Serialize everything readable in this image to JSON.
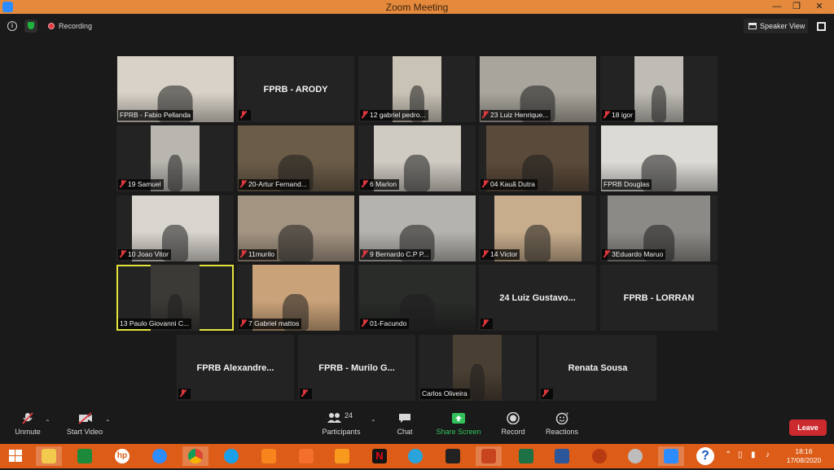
{
  "window": {
    "title": "Zoom Meeting"
  },
  "topbar": {
    "recording_label": "Recording",
    "speaker_view_label": "Speaker View"
  },
  "tiles": [
    {
      "name": "FPRB - Fabio Pellanda",
      "show_mic": false,
      "video": true,
      "bg": "#d8d2c8"
    },
    {
      "name": "FPRB - ARODY",
      "show_mic": true,
      "video": false
    },
    {
      "name": "12 gabriel pedro...",
      "show_mic": true,
      "video": true,
      "bg": "#c9c3b6"
    },
    {
      "name": "23 Luiz Henrique...",
      "show_mic": true,
      "video": true,
      "bg": "#a9a59c"
    },
    {
      "name": "18 igor",
      "show_mic": true,
      "video": true,
      "bg": "#bfbcb5"
    },
    {
      "name": "19 Samuel",
      "show_mic": true,
      "video": true,
      "bg": "#b9b6b0"
    },
    {
      "name": "20-Artur Fernand...",
      "show_mic": true,
      "video": true,
      "bg": "#6b5c48"
    },
    {
      "name": "6 Marlon",
      "show_mic": true,
      "video": true,
      "bg": "#cfcac2"
    },
    {
      "name": "04 Kauã Dutra",
      "show_mic": true,
      "video": true,
      "bg": "#5a4a3a"
    },
    {
      "name": "FPRB Douglas",
      "show_mic": false,
      "video": true,
      "bg": "#dcdad4"
    },
    {
      "name": "10 Joao Vitor",
      "show_mic": true,
      "video": true,
      "bg": "#d8d4ce"
    },
    {
      "name": "11murilo",
      "show_mic": true,
      "video": true,
      "bg": "#a39482"
    },
    {
      "name": "9 Bernardo C.P P...",
      "show_mic": true,
      "video": true,
      "bg": "#b5b3ae"
    },
    {
      "name": "14 Victor",
      "show_mic": true,
      "video": true,
      "bg": "#c7ad8c"
    },
    {
      "name": "3Eduardo Maruo",
      "show_mic": true,
      "video": true,
      "bg": "#8c8a86"
    },
    {
      "name": "13 Paulo Giovanni C...",
      "show_mic": false,
      "video": true,
      "bg": "#3c3a36"
    },
    {
      "name": "7 Gabriel mattos",
      "show_mic": true,
      "video": true,
      "bg": "#c9a27a"
    },
    {
      "name": "01-Facundo",
      "show_mic": true,
      "video": true,
      "bg": "#2a2c2a"
    },
    {
      "name": "24 Luiz Gustavo...",
      "show_mic": true,
      "video": false
    },
    {
      "name": "FPRB - LORRAN",
      "show_mic": false,
      "video": false
    },
    {
      "name": "FPRB  Alexandre...",
      "show_mic": true,
      "video": false
    },
    {
      "name": "FPRB - Murilo G...",
      "show_mic": true,
      "video": false
    },
    {
      "name": "Carlos Oliveira",
      "show_mic": false,
      "video": true,
      "bg": "#4a3f33"
    },
    {
      "name": "Renata Sousa",
      "show_mic": true,
      "video": false
    }
  ],
  "toolbar": {
    "unmute": "Unmute",
    "start_video": "Start Video",
    "participants_count": "24",
    "participants": "Participants",
    "chat": "Chat",
    "share_screen": "Share Screen",
    "record": "Record",
    "reactions": "Reactions",
    "leave": "Leave"
  },
  "taskbar": {
    "time": "18:16",
    "date": "17/08/2020"
  }
}
